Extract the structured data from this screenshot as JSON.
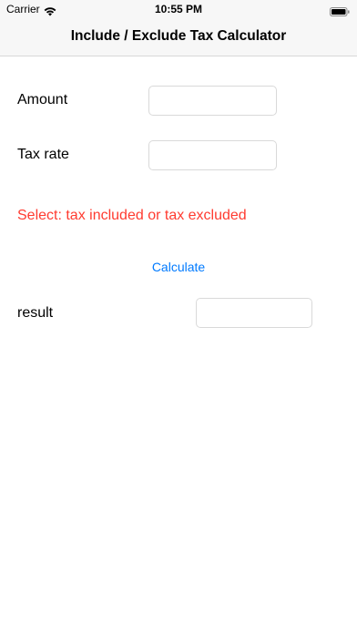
{
  "status_bar": {
    "carrier": "Carrier",
    "time": "10:55 PM",
    "icons": [
      "wifi-icon",
      "battery-icon"
    ]
  },
  "nav": {
    "title": "Include / Exclude Tax Calculator"
  },
  "form": {
    "amount_label": "Amount",
    "amount_value": "",
    "tax_rate_label": "Tax rate",
    "tax_rate_value": "",
    "warning": "Select: tax included or tax excluded",
    "calculate_label": "Calculate",
    "result_label": "result",
    "result_value": ""
  },
  "colors": {
    "warning": "#ff3b30",
    "accent": "#007aff",
    "nav_background": "#f7f7f7"
  }
}
